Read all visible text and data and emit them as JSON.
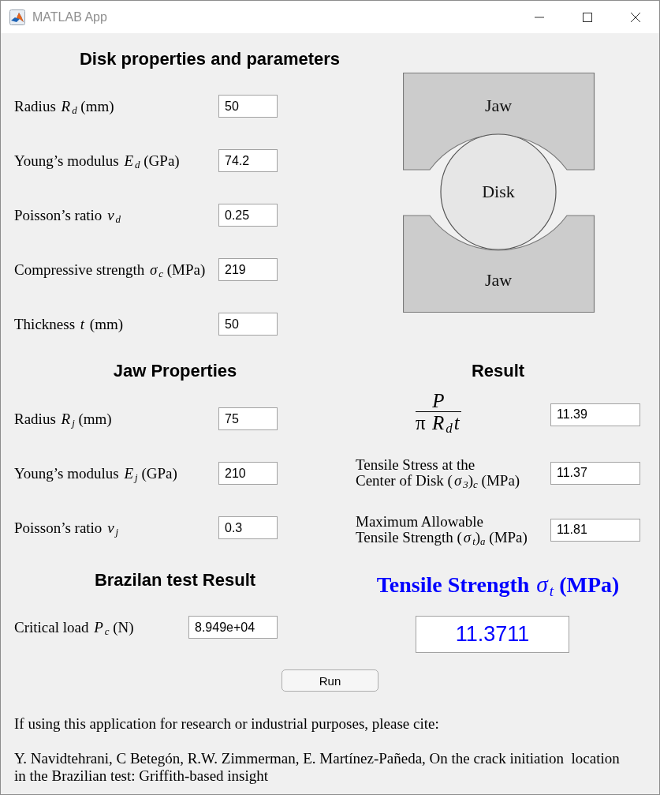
{
  "window": {
    "title": "MATLAB App"
  },
  "sections": [
    {
      "heading": "Disk properties and parameters",
      "fields": [
        {
          "label": "Radius *R*$_{d}$ (mm)",
          "value": "50"
        },
        {
          "label": "Young’s modulus *E*$_{d}$ (GPa)",
          "value": "74.2"
        },
        {
          "label": "Poisson’s ratio *ν*$_{d}$",
          "value": "0.25"
        },
        {
          "label": "Compressive strength *σ*$_{c}$ (MPa)",
          "value": "219"
        },
        {
          "label": "Thickness *t* (mm)",
          "value": "50"
        }
      ]
    },
    {
      "heading": "Jaw Properties",
      "fields": [
        {
          "label": "Radius *R*$_{j}$ (mm)",
          "value": "75"
        },
        {
          "label": "Young’s modulus *E*$_{j}$ (GPa)",
          "value": "210"
        },
        {
          "label": "Poisson’s ratio *ν*$_{j}$",
          "value": "0.3"
        }
      ]
    },
    {
      "heading": "Brazilan test Result",
      "fields": [
        {
          "label": "Critical load *P*$_{c}$ (N)",
          "value": "8.949e+04"
        }
      ]
    }
  ],
  "diagram": {
    "top_jaw_label": "Jaw",
    "disk_label": "Disk",
    "bottom_jaw_label": "Jaw"
  },
  "result": {
    "heading": "Result",
    "rows": [
      {
        "kind": "fraction",
        "numerator": "P",
        "denominator": "π *R*$_{d}$*t*",
        "value": "11.39"
      },
      {
        "kind": "label",
        "label": "Tensile Stress at the\nCenter of Disk (*σ*$_{3}$)$_{c}$ (MPa)",
        "value": "11.37"
      },
      {
        "kind": "label",
        "label": "Maximum Allowable\nTensile Strength (*σ*$_{t}$)$_{a}$ (MPa)",
        "value": "11.81"
      }
    ]
  },
  "tensile_strength": {
    "heading": "**Tensile Strength** *σ*$_{t}$ **(MPa)**",
    "value": "11.3711"
  },
  "run_button": {
    "label": "Run"
  },
  "citation": {
    "note": "If using this application for research or industrial purposes, please cite:",
    "reference": "Y. Navidtehrani, C Betegón, R.W. Zimmerman, E. Martínez-Pañeda, On the crack initiation  location in the Brazilian test: Griffith-based insight"
  }
}
